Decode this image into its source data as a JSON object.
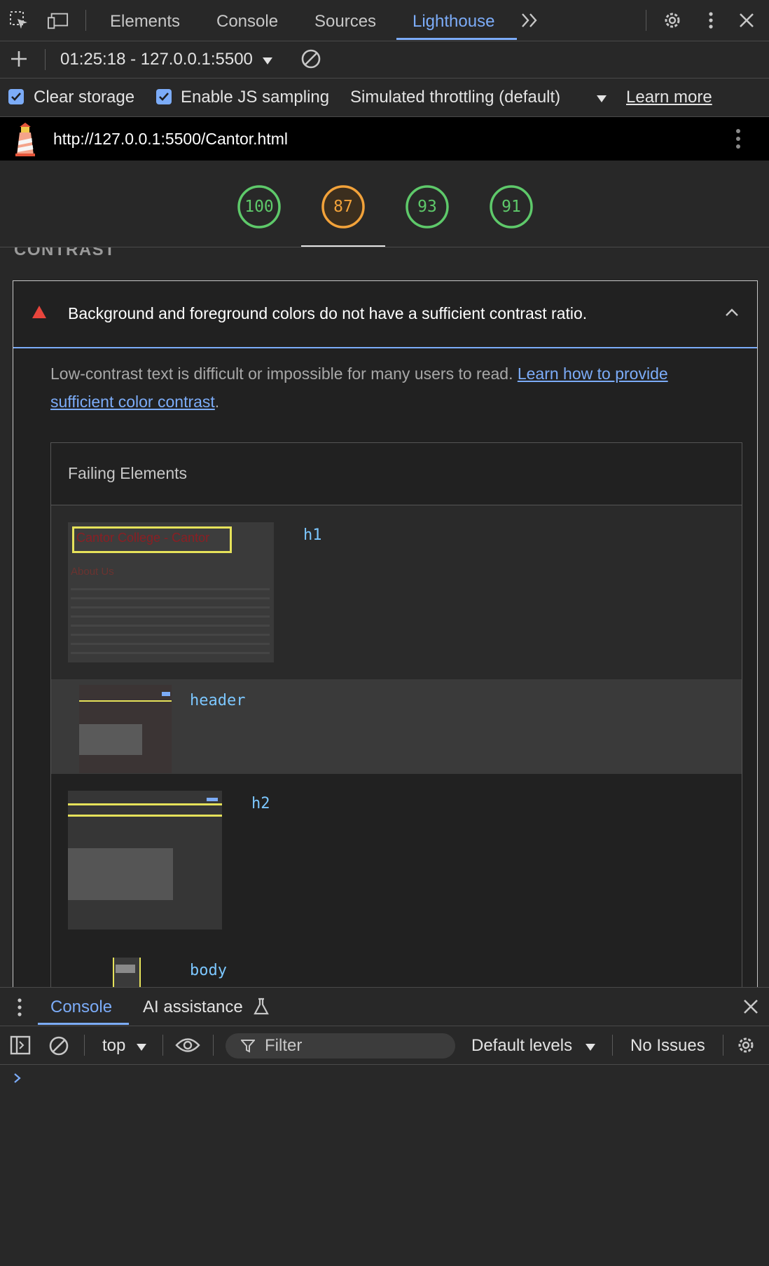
{
  "tabs": [
    "Elements",
    "Console",
    "Sources",
    "Lighthouse"
  ],
  "toolbar2": {
    "report_label": "01:25:18 - 127.0.0.1:5500"
  },
  "options": {
    "clear_storage": "Clear storage",
    "js_sampling": "Enable JS sampling",
    "throttling": "Simulated throttling (default)",
    "learn_more": "Learn more"
  },
  "url": "http://127.0.0.1:5500/Cantor.html",
  "scores": [
    {
      "value": "100",
      "color": "#5ec96a"
    },
    {
      "value": "87",
      "color": "#f2a23a"
    },
    {
      "value": "93",
      "color": "#5ec96a"
    },
    {
      "value": "91",
      "color": "#5ec96a"
    }
  ],
  "section_title": "CONTRAST",
  "audit": {
    "title": "Background and foreground colors do not have a sufficient contrast ratio.",
    "desc_prefix": "Low-contrast text is difficult or impossible for many users to read. ",
    "desc_link_1": "Learn how to provide",
    "desc_link_2": "sufficient color contrast",
    "desc_suffix": ".",
    "failing_header": "Failing Elements",
    "elements": [
      {
        "selector": "h1",
        "thumb_text": "Cantor College - Cantor",
        "thumb_sub": "About Us"
      },
      {
        "selector": "header"
      },
      {
        "selector": "h2"
      },
      {
        "selector": "body"
      }
    ]
  },
  "drawer": {
    "tab_console": "Console",
    "tab_ai": "AI assistance",
    "context": "top",
    "filter_placeholder": "Filter",
    "levels": "Default levels",
    "issues": "No Issues"
  },
  "colors": {
    "accent": "#7cacf8",
    "fail": "#e8453c",
    "code": "#7cc7ff"
  }
}
